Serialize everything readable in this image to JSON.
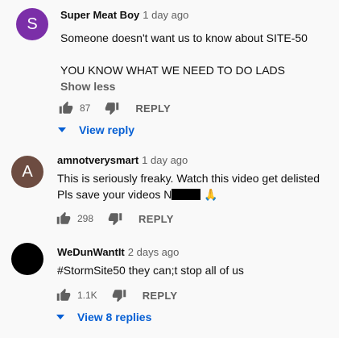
{
  "colors": {
    "page_bg": "#f9f9f9",
    "avatar_s": "#7b2fa8",
    "avatar_a": "#6d4c41",
    "avatar_w": "#000000",
    "link_blue": "#065fd4"
  },
  "comments": [
    {
      "avatar_letter": "S",
      "author": "Super Meat Boy",
      "time": "1 day ago",
      "lines": [
        "Someone doesn't want us to know about SITE-50",
        "",
        "YOU KNOW WHAT WE NEED TO DO LADS"
      ],
      "show_less": "Show less",
      "likes": "87",
      "reply_label": "REPLY",
      "view_replies": "View reply"
    },
    {
      "avatar_letter": "A",
      "author": "amnotverysmart",
      "time": "1 day ago",
      "lines": [
        "This is seriously freaky. Watch this video get delisted",
        "Pls save your videos N"
      ],
      "emoji": "🙏",
      "likes": "298",
      "reply_label": "REPLY"
    },
    {
      "avatar_letter": "",
      "author": "WeDunWantIt",
      "time": "2 days ago",
      "lines": [
        "#StormSite50 they can;t stop all of us"
      ],
      "likes": "1.1K",
      "reply_label": "REPLY",
      "view_replies": "View 8 replies"
    }
  ]
}
